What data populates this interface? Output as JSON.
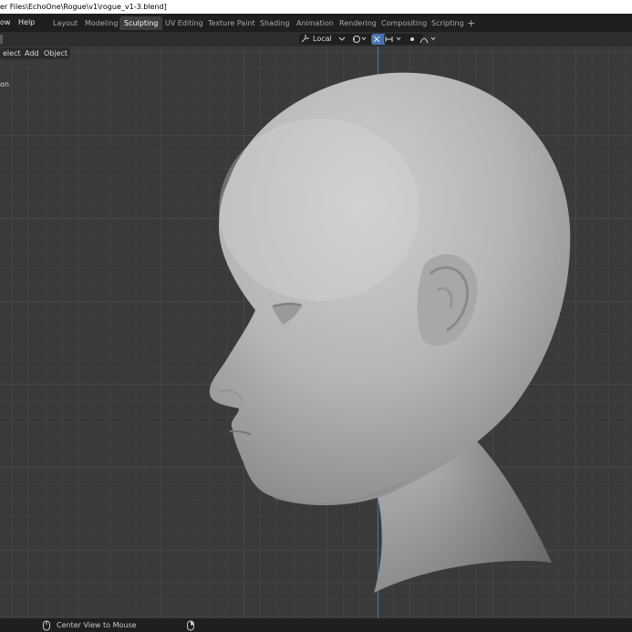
{
  "titlebar": {
    "text": "er Files\\EchoOne\\Rogue\\v1\\rogue_v1-3.blend]"
  },
  "menubar": {
    "items": [
      "ow",
      "Help"
    ],
    "workspaces": [
      "Layout",
      "Modeling",
      "Sculpting",
      "UV Editing",
      "Texture Paint",
      "Shading",
      "Animation",
      "Rendering",
      "Compositing",
      "Scripting"
    ],
    "active_workspace": "Sculpting",
    "add_label": "+"
  },
  "header": {
    "transform_orientation": "Local"
  },
  "viewport_menu": [
    "elect",
    "Add",
    "Object"
  ],
  "side_text": "on",
  "statusbar": {
    "hint": "Center View to Mouse"
  }
}
